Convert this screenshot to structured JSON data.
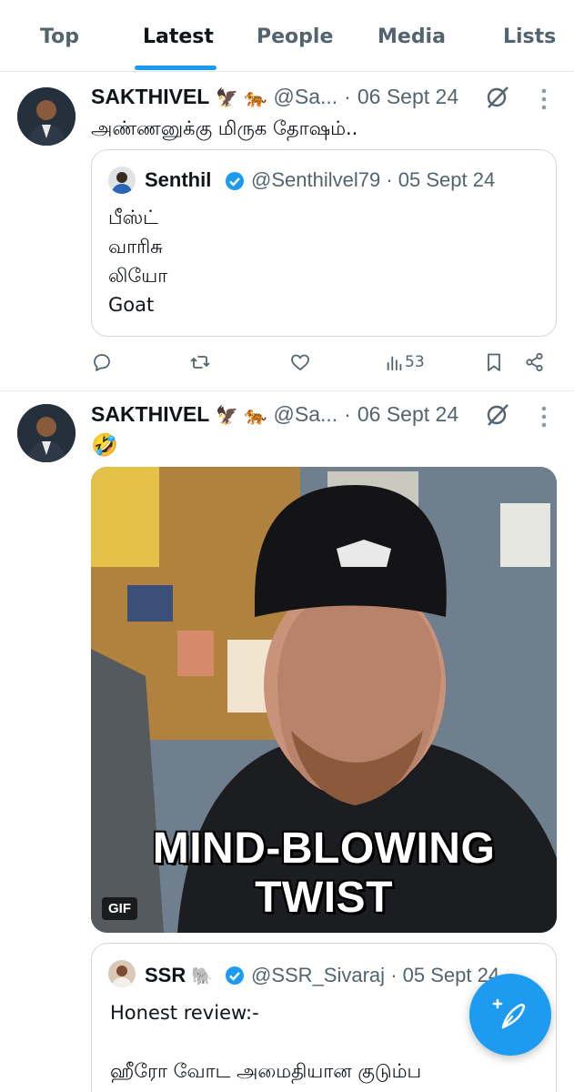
{
  "tabs": [
    {
      "label": "Top"
    },
    {
      "label": "Latest"
    },
    {
      "label": "People"
    },
    {
      "label": "Media"
    },
    {
      "label": "Lists"
    }
  ],
  "active_tab": "Latest",
  "tweets": [
    {
      "name": "SAKTHIVEL",
      "emojis": "🦅 🐅",
      "handle": "@Sa...",
      "dot": "·",
      "date": "06 Sept 24",
      "text": "அண்ணனுக்கு மிருக தோஷம்..",
      "quote": {
        "name": "Senthil",
        "handle": "@Senthilvel79",
        "dot": "·",
        "date": "05 Sept 24",
        "lines": [
          "பீஸ்ட்",
          "வாரிசு",
          "லியோ",
          "Goat"
        ]
      },
      "actions": {
        "views": "53"
      }
    },
    {
      "name": "SAKTHIVEL",
      "emojis": "🦅 🐅",
      "handle": "@Sa...",
      "dot": "·",
      "date": "06 Sept 24",
      "text": "🤣",
      "media": {
        "badge": "GIF",
        "caption_line1": "MIND-BLOWING",
        "caption_line2": "TWIST"
      },
      "quote": {
        "name": "SSR",
        "emojis": "🐘",
        "handle": "@SSR_Sivaraj",
        "dot": "·",
        "date": "05 Sept 24",
        "lines": [
          "Honest review:-",
          "",
          "ஹீரோ வோட அமைதியான குடும்ப"
        ]
      }
    }
  ],
  "colors": {
    "accent": "#1d9bf0",
    "secondary_text": "#536471",
    "border": "#cfd9de"
  },
  "icons": {
    "compose": "compose-post-icon",
    "grok": "grok-icon",
    "more": "more-icon"
  }
}
